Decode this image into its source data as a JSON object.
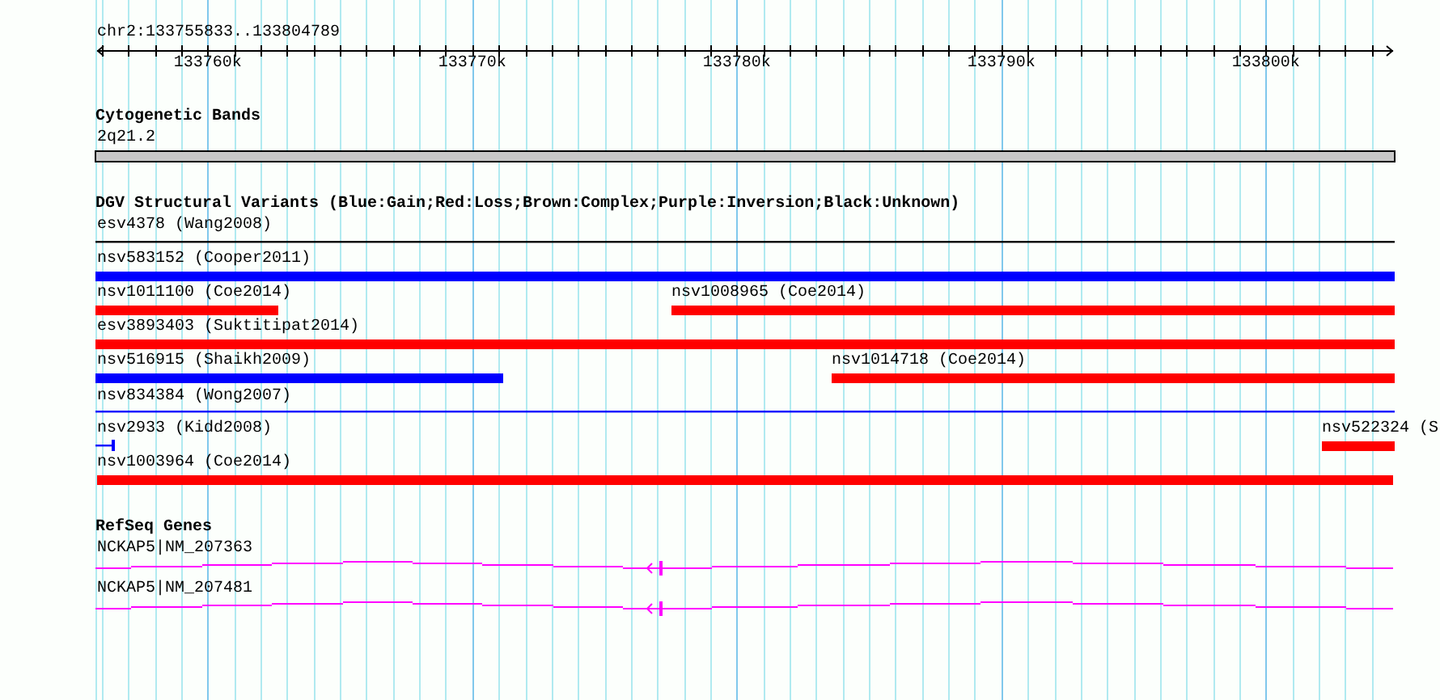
{
  "ruler": {
    "position": "chr2:133755833..133804789",
    "ticks": [
      "133760k",
      "133770k",
      "133780k",
      "133790k",
      "133800k"
    ]
  },
  "tracks": [
    {
      "title": "Cytogenetic Bands",
      "features": [
        {
          "label": "2q21.2",
          "kind": "band"
        }
      ]
    },
    {
      "title": "DGV Structural Variants (Blue:Gain;Red:Loss;Brown:Complex;Purple:Inversion;Black:Unknown)",
      "features": [
        {
          "label": "esv4378 (Wang2008)",
          "kind": "line",
          "color": "#000000"
        },
        {
          "label": "nsv583152 (Cooper2011)",
          "kind": "bar",
          "color": "#0000ff"
        },
        {
          "label": "nsv1011100 (Coe2014)",
          "kind": "bar",
          "color": "#ff0000"
        },
        {
          "label": "nsv1008965 (Coe2014)",
          "kind": "bar",
          "color": "#ff0000"
        },
        {
          "label": "esv3893403 (Suktitipat2014)",
          "kind": "bar",
          "color": "#ff0000"
        },
        {
          "label": "nsv516915 (Shaikh2009)",
          "kind": "bar",
          "color": "#0000ff"
        },
        {
          "label": "nsv1014718 (Coe2014)",
          "kind": "bar",
          "color": "#ff0000"
        },
        {
          "label": "nsv834384 (Wong2007)",
          "kind": "line",
          "color": "#0000ff"
        },
        {
          "label": "nsv2933 (Kidd2008)",
          "kind": "line",
          "color": "#0000ff"
        },
        {
          "label": "nsv522324 (S",
          "kind": "bar",
          "color": "#ff0000"
        },
        {
          "label": "nsv1003964 (Coe2014)",
          "kind": "bar",
          "color": "#ff0000"
        }
      ]
    },
    {
      "title": "RefSeq Genes",
      "features": [
        {
          "label": "NCKAP5|NM_207363",
          "kind": "gene"
        },
        {
          "label": "NCKAP5|NM_207481",
          "kind": "gene"
        }
      ]
    }
  ]
}
